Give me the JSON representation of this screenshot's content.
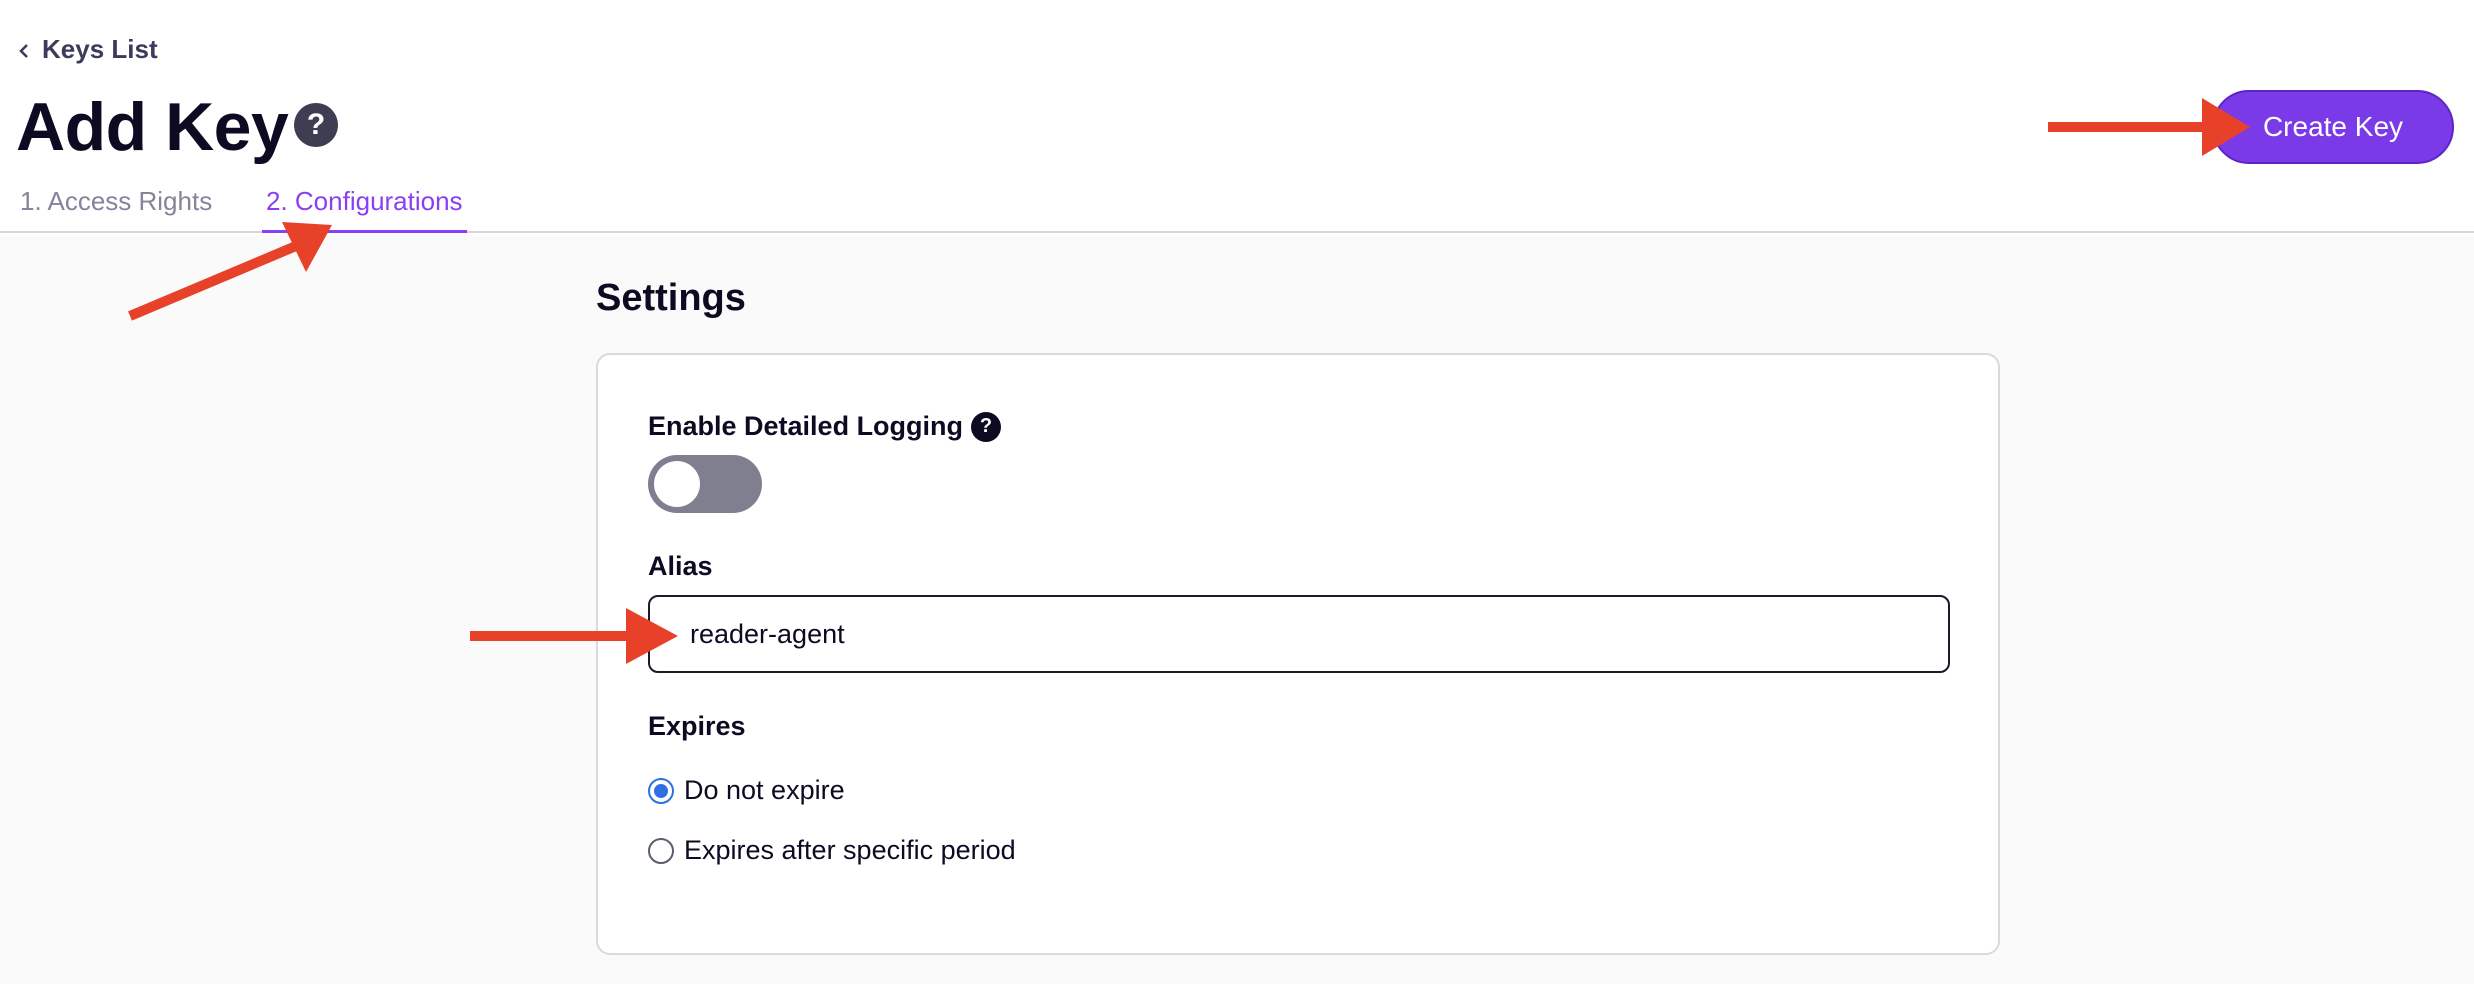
{
  "breadcrumb": {
    "label": "Keys List",
    "icon": "chevron-left-icon"
  },
  "header": {
    "title": "Add Key",
    "help_icon": "?",
    "create_button": "Create Key",
    "tabs": [
      {
        "label": "1. Access Rights",
        "active": false
      },
      {
        "label": "2. Configurations",
        "active": true
      }
    ]
  },
  "settings": {
    "title": "Settings",
    "logging": {
      "label": "Enable Detailed Logging",
      "help_icon": "?",
      "enabled": false
    },
    "alias": {
      "label": "Alias",
      "value": "reader-agent"
    },
    "expires": {
      "label": "Expires",
      "options": [
        {
          "label": "Do not expire",
          "checked": true
        },
        {
          "label": "Expires after specific period",
          "checked": false
        }
      ]
    }
  },
  "colors": {
    "accent": "#7a3ae8",
    "tab_active": "#8a3ff2",
    "annotation_arrow": "#e8412a",
    "radio_checked": "#2f6fe4"
  }
}
